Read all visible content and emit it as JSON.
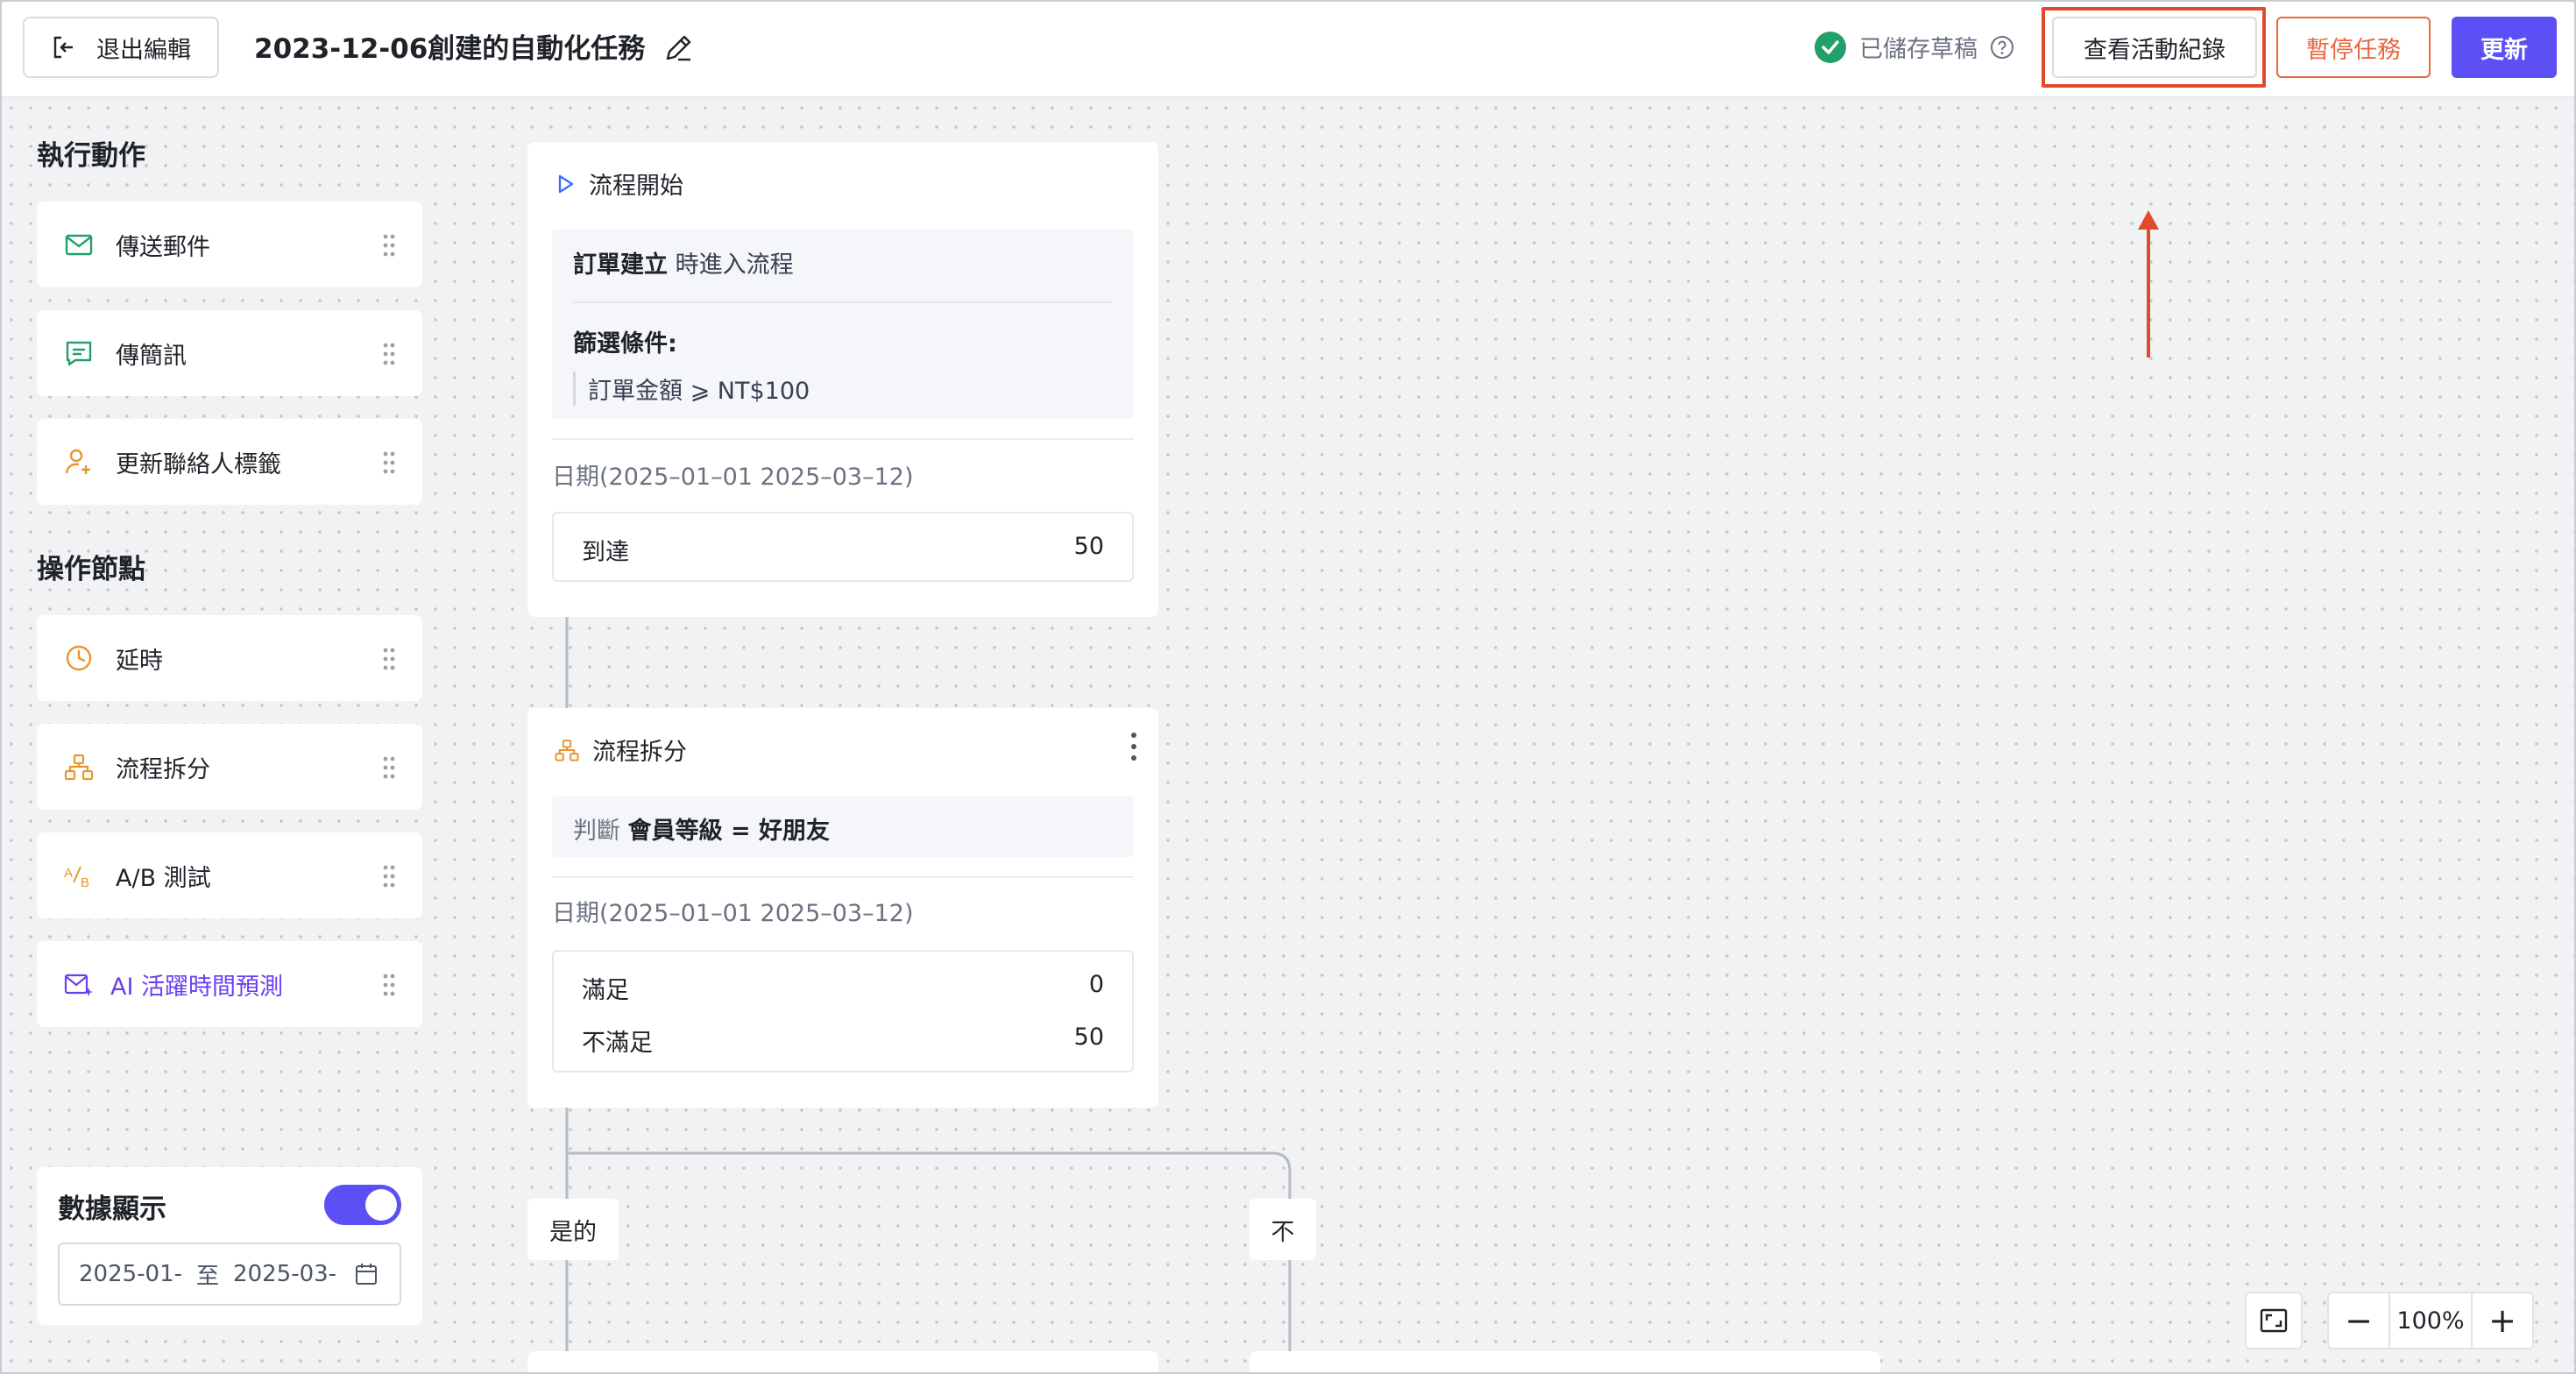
{
  "header": {
    "exit_label": "退出編輯",
    "title": "2023-12-06創建的自動化任務",
    "saved_label": "已儲存草稿",
    "view_log_label": "查看活動紀錄",
    "pause_label": "暫停任務",
    "update_label": "更新"
  },
  "colors": {
    "accent": "#5b4ff5",
    "pause": "#e9663e",
    "highlight": "#e04b2c",
    "success": "#22a06b"
  },
  "sidebar": {
    "actions_title": "執行動作",
    "actions": [
      {
        "label": "傳送郵件",
        "icon": "mail-icon"
      },
      {
        "label": "傳簡訊",
        "icon": "message-icon"
      },
      {
        "label": "更新聯絡人標籤",
        "icon": "user-plus-icon"
      }
    ],
    "operations_title": "操作節點",
    "operations": [
      {
        "label": "延時",
        "icon": "clock-icon"
      },
      {
        "label": "流程拆分",
        "icon": "split-icon"
      },
      {
        "label": "A/B 測試",
        "icon": "ab-test-icon"
      },
      {
        "label": "AI 活躍時間預測",
        "icon": "ai-predict-icon"
      }
    ],
    "data_display": {
      "title": "數據顯示",
      "enabled": true,
      "start": "2025-01-",
      "separator": "至",
      "end": "2025-03-"
    }
  },
  "flow": {
    "start_node": {
      "title": "流程開始",
      "trigger_bold": "訂單建立",
      "trigger_rest": "時進入流程",
      "filter_title": "篩選條件:",
      "filter_value": "訂單金額 ⩾ NT$100",
      "date_label": "日期(2025–01–01 2025–03–12)",
      "stats": [
        {
          "label": "到達",
          "value": "50"
        }
      ]
    },
    "split_node": {
      "title": "流程拆分",
      "judge_prefix": "判斷",
      "judge_value": "會員等級 = 好朋友",
      "date_label": "日期(2025–01–01 2025–03–12)",
      "stats": [
        {
          "label": "滿足",
          "value": "0"
        },
        {
          "label": "不滿足",
          "value": "50"
        }
      ]
    },
    "branches": {
      "yes": "是的",
      "no": "不"
    }
  },
  "zoom": {
    "value": "100%",
    "minus": "−",
    "plus": "+"
  }
}
